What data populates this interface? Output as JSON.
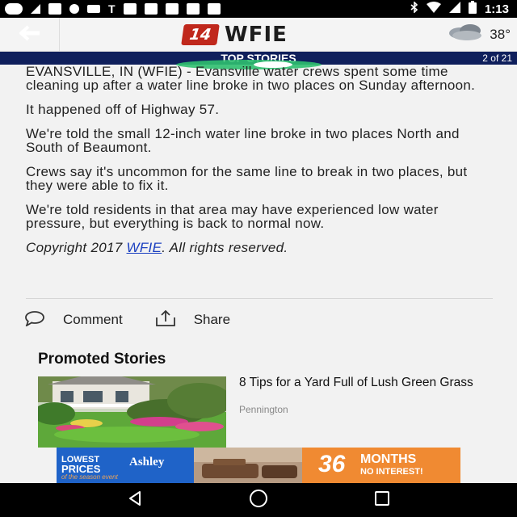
{
  "status_bar": {
    "time": "1:13",
    "notification_glyph": "T"
  },
  "app_bar": {
    "logo_number": "14",
    "logo_text": "WFIE",
    "weather_temp": "38°",
    "weather_icon": "cloudy-icon"
  },
  "section": {
    "title": "TOP STORIES",
    "counter": "2 of 21"
  },
  "article": {
    "paragraphs": [
      "EVANSVILLE, IN (WFIE) - Evansville water crews spent some time cleaning up after a water line broke in two places on Sunday afternoon.",
      "It happened off of Highway 57.",
      "We're told the small 12-inch water line broke in two places North and South of Beaumont.",
      "Crews say it's uncommon for the same line to break in two places, but they were able to fix it.",
      "We're told residents in that area may have experienced low water pressure, but everything is back to normal now."
    ],
    "copyright_prefix": "Copyright 2017 ",
    "copyright_link": "WFIE",
    "copyright_suffix": ". All rights reserved."
  },
  "actions": {
    "comment_label": "Comment",
    "share_label": "Share"
  },
  "promoted": {
    "title": "Promoted Stories",
    "items": [
      {
        "headline": "8 Tips for a Yard Full of Lush Green Grass",
        "source": "Pennington"
      }
    ]
  },
  "ad": {
    "left_line1": "LOWEST",
    "left_line2": "PRICES",
    "left_tag": "of the season event",
    "brand": "Ashley",
    "right_big": "36",
    "right_months": "MONTHS",
    "right_small": "NO INTEREST!"
  },
  "colors": {
    "section_bar": "#0f1f5c",
    "link": "#1a3fc0",
    "logo_red": "#c0281c",
    "indicator_green": "#2fbf6f"
  }
}
